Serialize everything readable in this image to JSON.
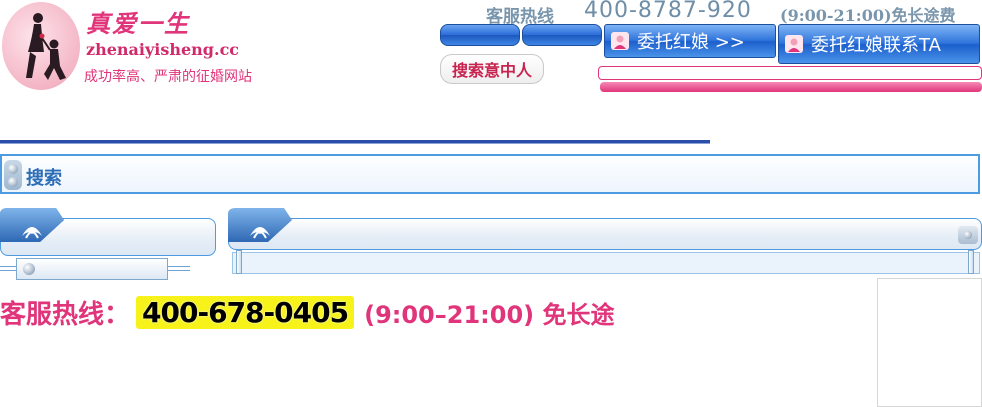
{
  "logo": {
    "title": "真爱一生",
    "domain": "zhenaiyisheng.cc",
    "slogan": "成功率高、严肃的征婚网站"
  },
  "top_hotline": {
    "label": "客服热线",
    "number": "400-8787-920",
    "hours": "(9:00-21:00)免长途费"
  },
  "buttons": {
    "entrust_matchmaker": "委托红娘 >>",
    "entrust_contact": "委托红娘联系TA",
    "search_mate": "搜索意中人"
  },
  "search": {
    "label": "搜索"
  },
  "hotline_banner": {
    "label": "客服热线：",
    "number": "400-678-0405",
    "hours": "(9:00–21:00) 免长途"
  },
  "colors": {
    "brand_pink": "#e0357a",
    "brand_blue": "#2f74dc",
    "highlight_yellow": "#f6f21a"
  }
}
